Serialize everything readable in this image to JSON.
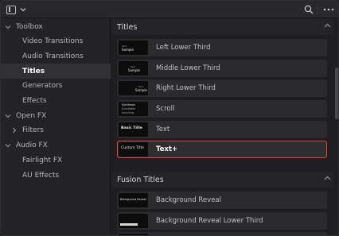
{
  "sidebar": {
    "items": [
      {
        "label": "Toolbox",
        "level": 0,
        "expanded": true
      },
      {
        "label": "Video Transitions",
        "level": 1
      },
      {
        "label": "Audio Transitions",
        "level": 1
      },
      {
        "label": "Titles",
        "level": 1,
        "selected": true
      },
      {
        "label": "Generators",
        "level": 1
      },
      {
        "label": "Effects",
        "level": 1
      },
      {
        "label": "Open FX",
        "level": 0,
        "expanded": true
      },
      {
        "label": "Filters",
        "level": 1,
        "expanded": false
      },
      {
        "label": "Audio FX",
        "level": 0,
        "expanded": true
      },
      {
        "label": "Fairlight FX",
        "level": 1
      },
      {
        "label": "AU Effects",
        "level": 1
      }
    ]
  },
  "main": {
    "sections": [
      {
        "title": "Titles",
        "items": [
          {
            "name": "Left Lower Third",
            "thumb_text": [
              "Text",
              "Sample"
            ]
          },
          {
            "name": "Middle Lower Third",
            "thumb_text": [
              "Text",
              "Sample"
            ]
          },
          {
            "name": "Right Lower Third",
            "thumb_text": [
              "Text",
              "Sample"
            ]
          },
          {
            "name": "Scroll",
            "thumb_text": [
              "Synthesis",
              "Scrollable",
              "Scrolling"
            ]
          },
          {
            "name": "Text",
            "thumb_text": [
              "Basic Title"
            ]
          },
          {
            "name": "Text+",
            "thumb_text": [
              "Custom Title"
            ],
            "selected": true
          }
        ]
      },
      {
        "title": "Fusion Titles",
        "items": [
          {
            "name": "Background Reveal",
            "thumb_text": [
              "Background Reveal"
            ]
          },
          {
            "name": "Background Reveal Lower Third",
            "thumb_text": [
              ""
            ]
          }
        ]
      }
    ]
  },
  "colors": {
    "selection_border": "#e8413a",
    "background": "#1e1e20",
    "sidebar_bg": "#232326",
    "tile_bg": "#2b2b2e"
  },
  "icons": {
    "panel_toggle": "sidebar-panel-icon",
    "dropdown": "chevron-down-icon",
    "search": "search-icon",
    "more": "more-dots-icon"
  }
}
